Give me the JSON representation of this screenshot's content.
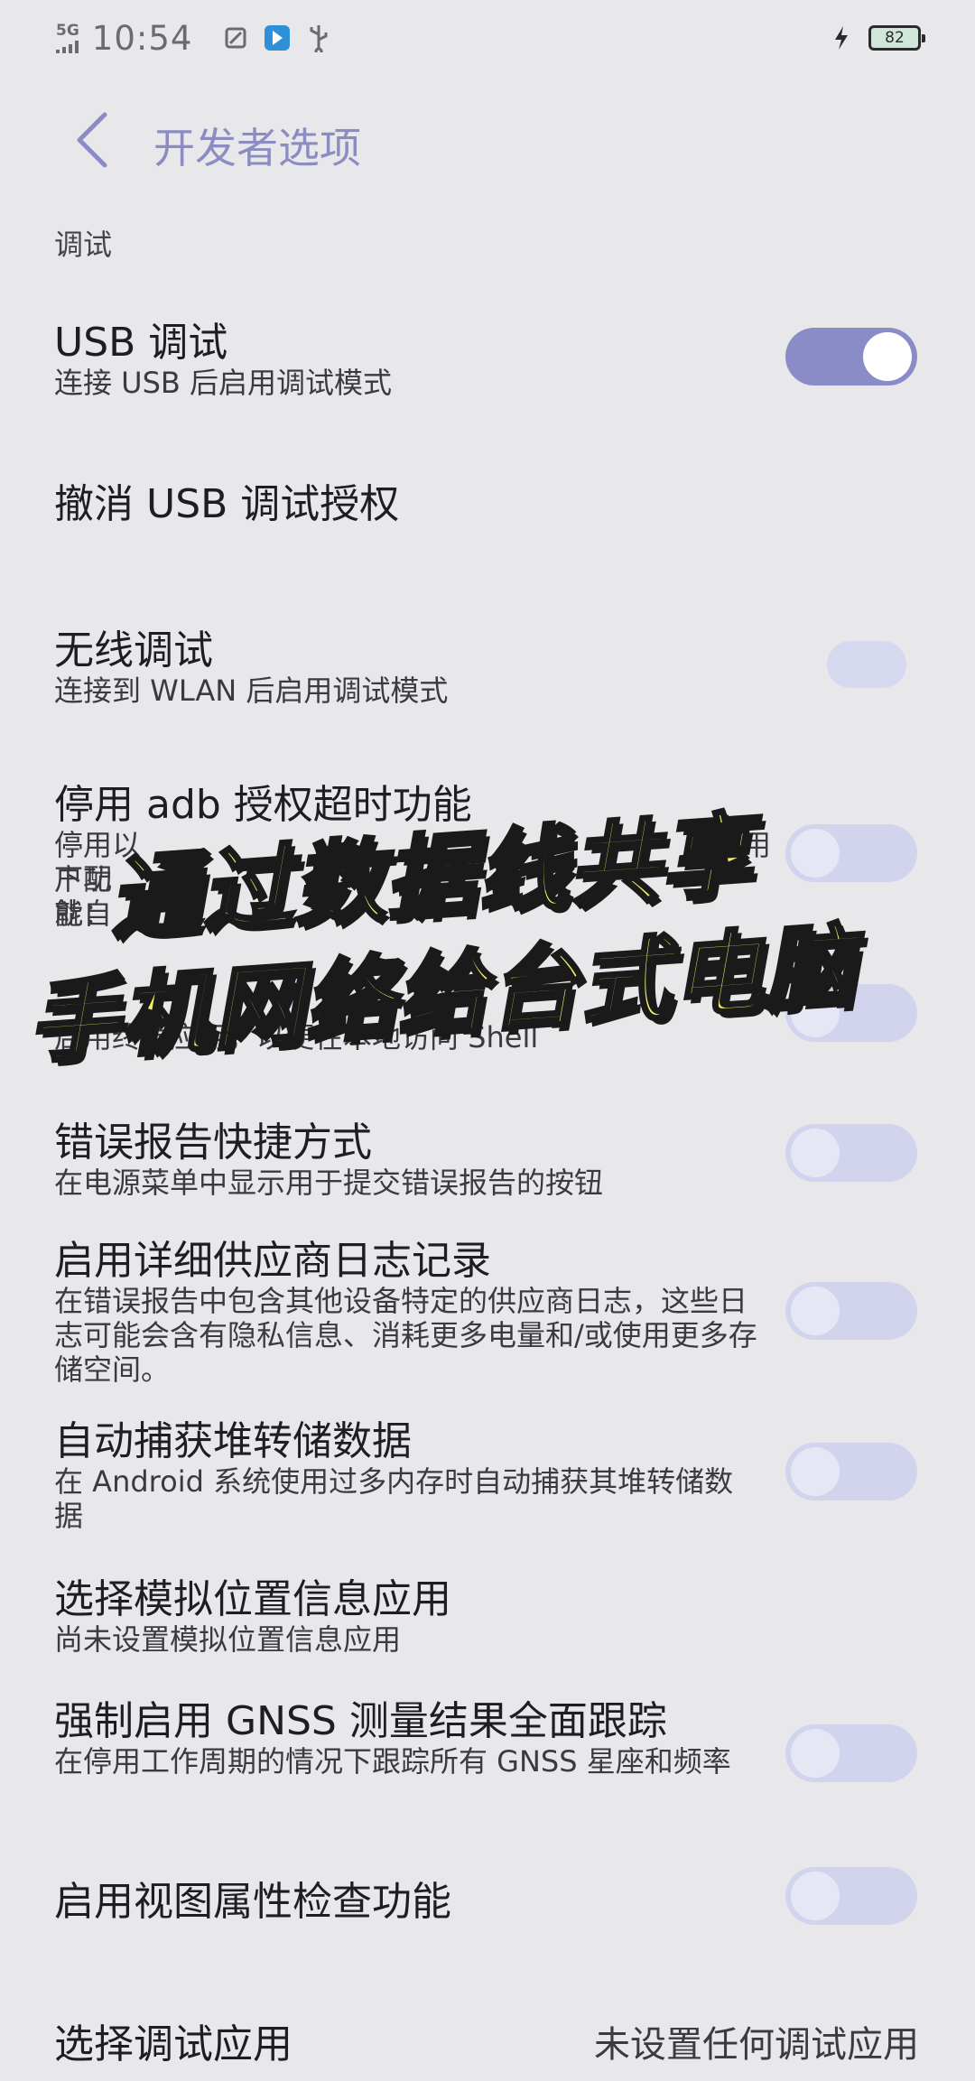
{
  "status_bar": {
    "network": "5G",
    "time": "10:54",
    "battery": "82",
    "icons": [
      "screenshot-icon",
      "app-notification-icon",
      "usb-icon",
      "charging-icon"
    ]
  },
  "header": {
    "title": "开发者选项",
    "back_icon": "back-chevron-icon"
  },
  "section": "调试",
  "items": [
    {
      "title": "USB 调试",
      "desc": "连接 USB 后启用调试模式",
      "toggle": "on"
    },
    {
      "title": "撤消 USB 调试授权"
    },
    {
      "title": "无线调试",
      "desc": "连接到 WLAN 后启用调试模式",
      "toggle": "faded"
    },
    {
      "title": "停用 adb 授权超时功能",
      "desc_lines": [
        "停用以下功能：",
        "户配",
        "就自"
      ],
      "desc_right": "用",
      "toggle": "off"
    },
    {
      "desc": "启用终端应用，以便在本地访问 Shell",
      "toggle": "off"
    },
    {
      "title": "错误报告快捷方式",
      "desc": "在电源菜单中显示用于提交错误报告的按钮",
      "toggle": "off"
    },
    {
      "title": "启用详细供应商日志记录",
      "desc": "在错误报告中包含其他设备特定的供应商日志，这些日志可能会含有隐私信息、消耗更多电量和/或使用更多存储空间。",
      "toggle": "off"
    },
    {
      "title": "自动捕获堆转储数据",
      "desc": "在 Android 系统使用过多内存时自动捕获其堆转储数据",
      "toggle": "off"
    },
    {
      "title": "选择模拟位置信息应用",
      "desc": "尚未设置模拟位置信息应用"
    },
    {
      "title": "强制启用 GNSS 测量结果全面跟踪",
      "desc": "在停用工作周期的情况下跟踪所有 GNSS 星座和频率",
      "toggle": "off"
    },
    {
      "title": "启用视图属性检查功能",
      "toggle": "off"
    },
    {
      "title": "选择调试应用",
      "value": "未设置任何调试应用"
    }
  ],
  "overlay": {
    "line1": "通过数据线共享",
    "line2": "手机网络给台式电脑"
  },
  "colors": {
    "accent": "#8a8cc8",
    "title": "#8a8cc2",
    "overlay_text": "#f3ee6c"
  }
}
